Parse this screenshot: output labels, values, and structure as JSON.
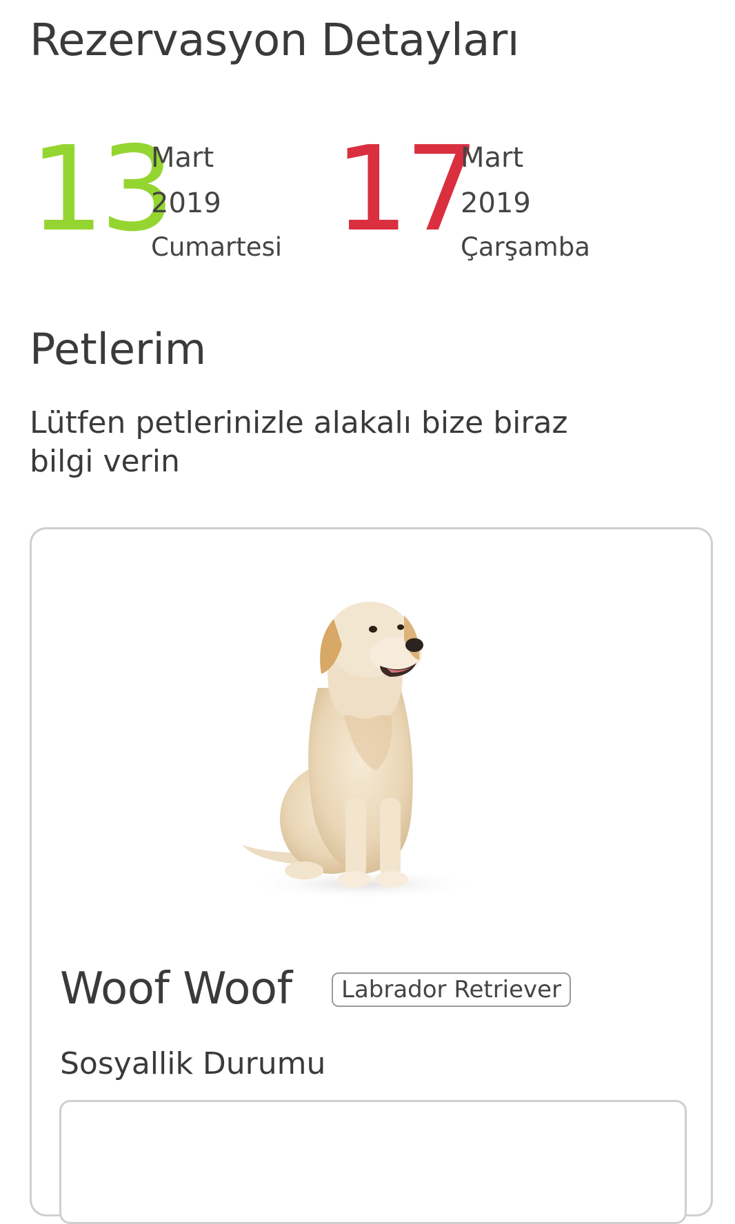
{
  "header": {
    "title": "Rezervasyon Detayları"
  },
  "dates": {
    "checkin": {
      "day": "13",
      "month": "Mart",
      "year": "2019",
      "weekday": "Cumartesi",
      "color": "#95d531"
    },
    "checkout": {
      "day": "17",
      "month": "Mart",
      "year": "2019",
      "weekday": "Çarşamba",
      "color": "#d92f3f"
    }
  },
  "pets_section": {
    "title": "Petlerim",
    "description": "Lütfen petlerinizle alakalı bize biraz bilgi verin"
  },
  "pet": {
    "name": "Woof Woof",
    "breed": "Labrador Retriever",
    "photo_icon": "dog-photo",
    "social_label": "Sosyallik Durumu",
    "social_value": ""
  }
}
